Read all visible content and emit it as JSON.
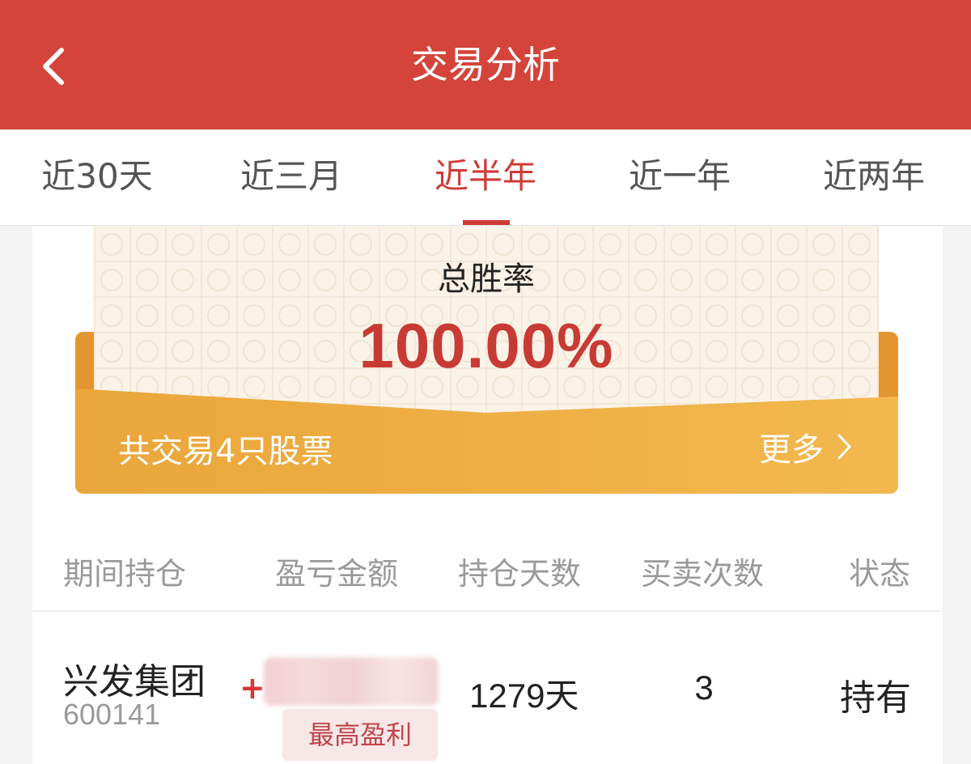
{
  "header": {
    "title": "交易分析"
  },
  "tabs": [
    "近30天",
    "近三月",
    "近半年",
    "近一年",
    "近两年"
  ],
  "active_tab": "近半年",
  "summary": {
    "win_rate_label": "总胜率",
    "win_rate_value": "100.00%",
    "trade_count_text": "共交易4只股票",
    "more_label": "更多"
  },
  "table": {
    "columns": [
      "期间持仓",
      "盈亏金额",
      "持仓天数",
      "买卖次数",
      "状态"
    ],
    "rows": [
      {
        "name": "兴发集团",
        "code": "600141",
        "pnl_sign": "+",
        "tag": "最高盈利",
        "days": "1279天",
        "trades": "3",
        "status": "持有"
      }
    ]
  },
  "colors": {
    "header_bg": "#d4443b",
    "accent": "#cf3b35",
    "envelope": "#eba93f"
  }
}
